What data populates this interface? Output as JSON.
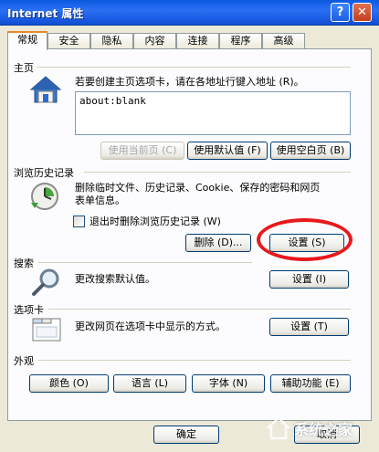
{
  "window": {
    "title": "Internet 属性",
    "help_label": "?",
    "close_label": "✕"
  },
  "tabs": [
    {
      "label": "常规"
    },
    {
      "label": "安全"
    },
    {
      "label": "隐私"
    },
    {
      "label": "内容"
    },
    {
      "label": "连接"
    },
    {
      "label": "程序"
    },
    {
      "label": "高级"
    }
  ],
  "homepage": {
    "label": "主页",
    "description": "若要创建主页选项卡，请在各地址行键入地址 (R)。",
    "url_value": "about:blank",
    "buttons": {
      "use_current": "使用当前页 (C)",
      "use_default": "使用默认值 (F)",
      "use_blank": "使用空白页 (B)"
    }
  },
  "history": {
    "label": "浏览历史记录",
    "description_1": "删除临时文件、历史记录、Cookie、保存的密码和网页",
    "description_2": "表单信息。",
    "checkbox_label": "退出时删除浏览历史记录 (W)",
    "delete_button": "删除 (D)...",
    "settings_button": "设置 (S)"
  },
  "search": {
    "label": "搜索",
    "description": "更改搜索默认值。",
    "settings_button": "设置 (I)"
  },
  "tabs_section": {
    "label": "选项卡",
    "description": "更改网页在选项卡中显示的方式。",
    "settings_button": "设置 (T)"
  },
  "appearance": {
    "label": "外观",
    "buttons": {
      "colors": "颜色 (O)",
      "languages": "语言 (L)",
      "fonts": "字体 (N)",
      "accessibility": "辅助功能 (E)"
    }
  },
  "footer": {
    "ok_button": "确定",
    "cancel_button": "取消"
  },
  "watermark": {
    "text": "系统之家"
  },
  "colors": {
    "highlight_ring": "#e8191b",
    "titlebar": "#1e5fe7",
    "tab_accent": "#e68b2c"
  }
}
